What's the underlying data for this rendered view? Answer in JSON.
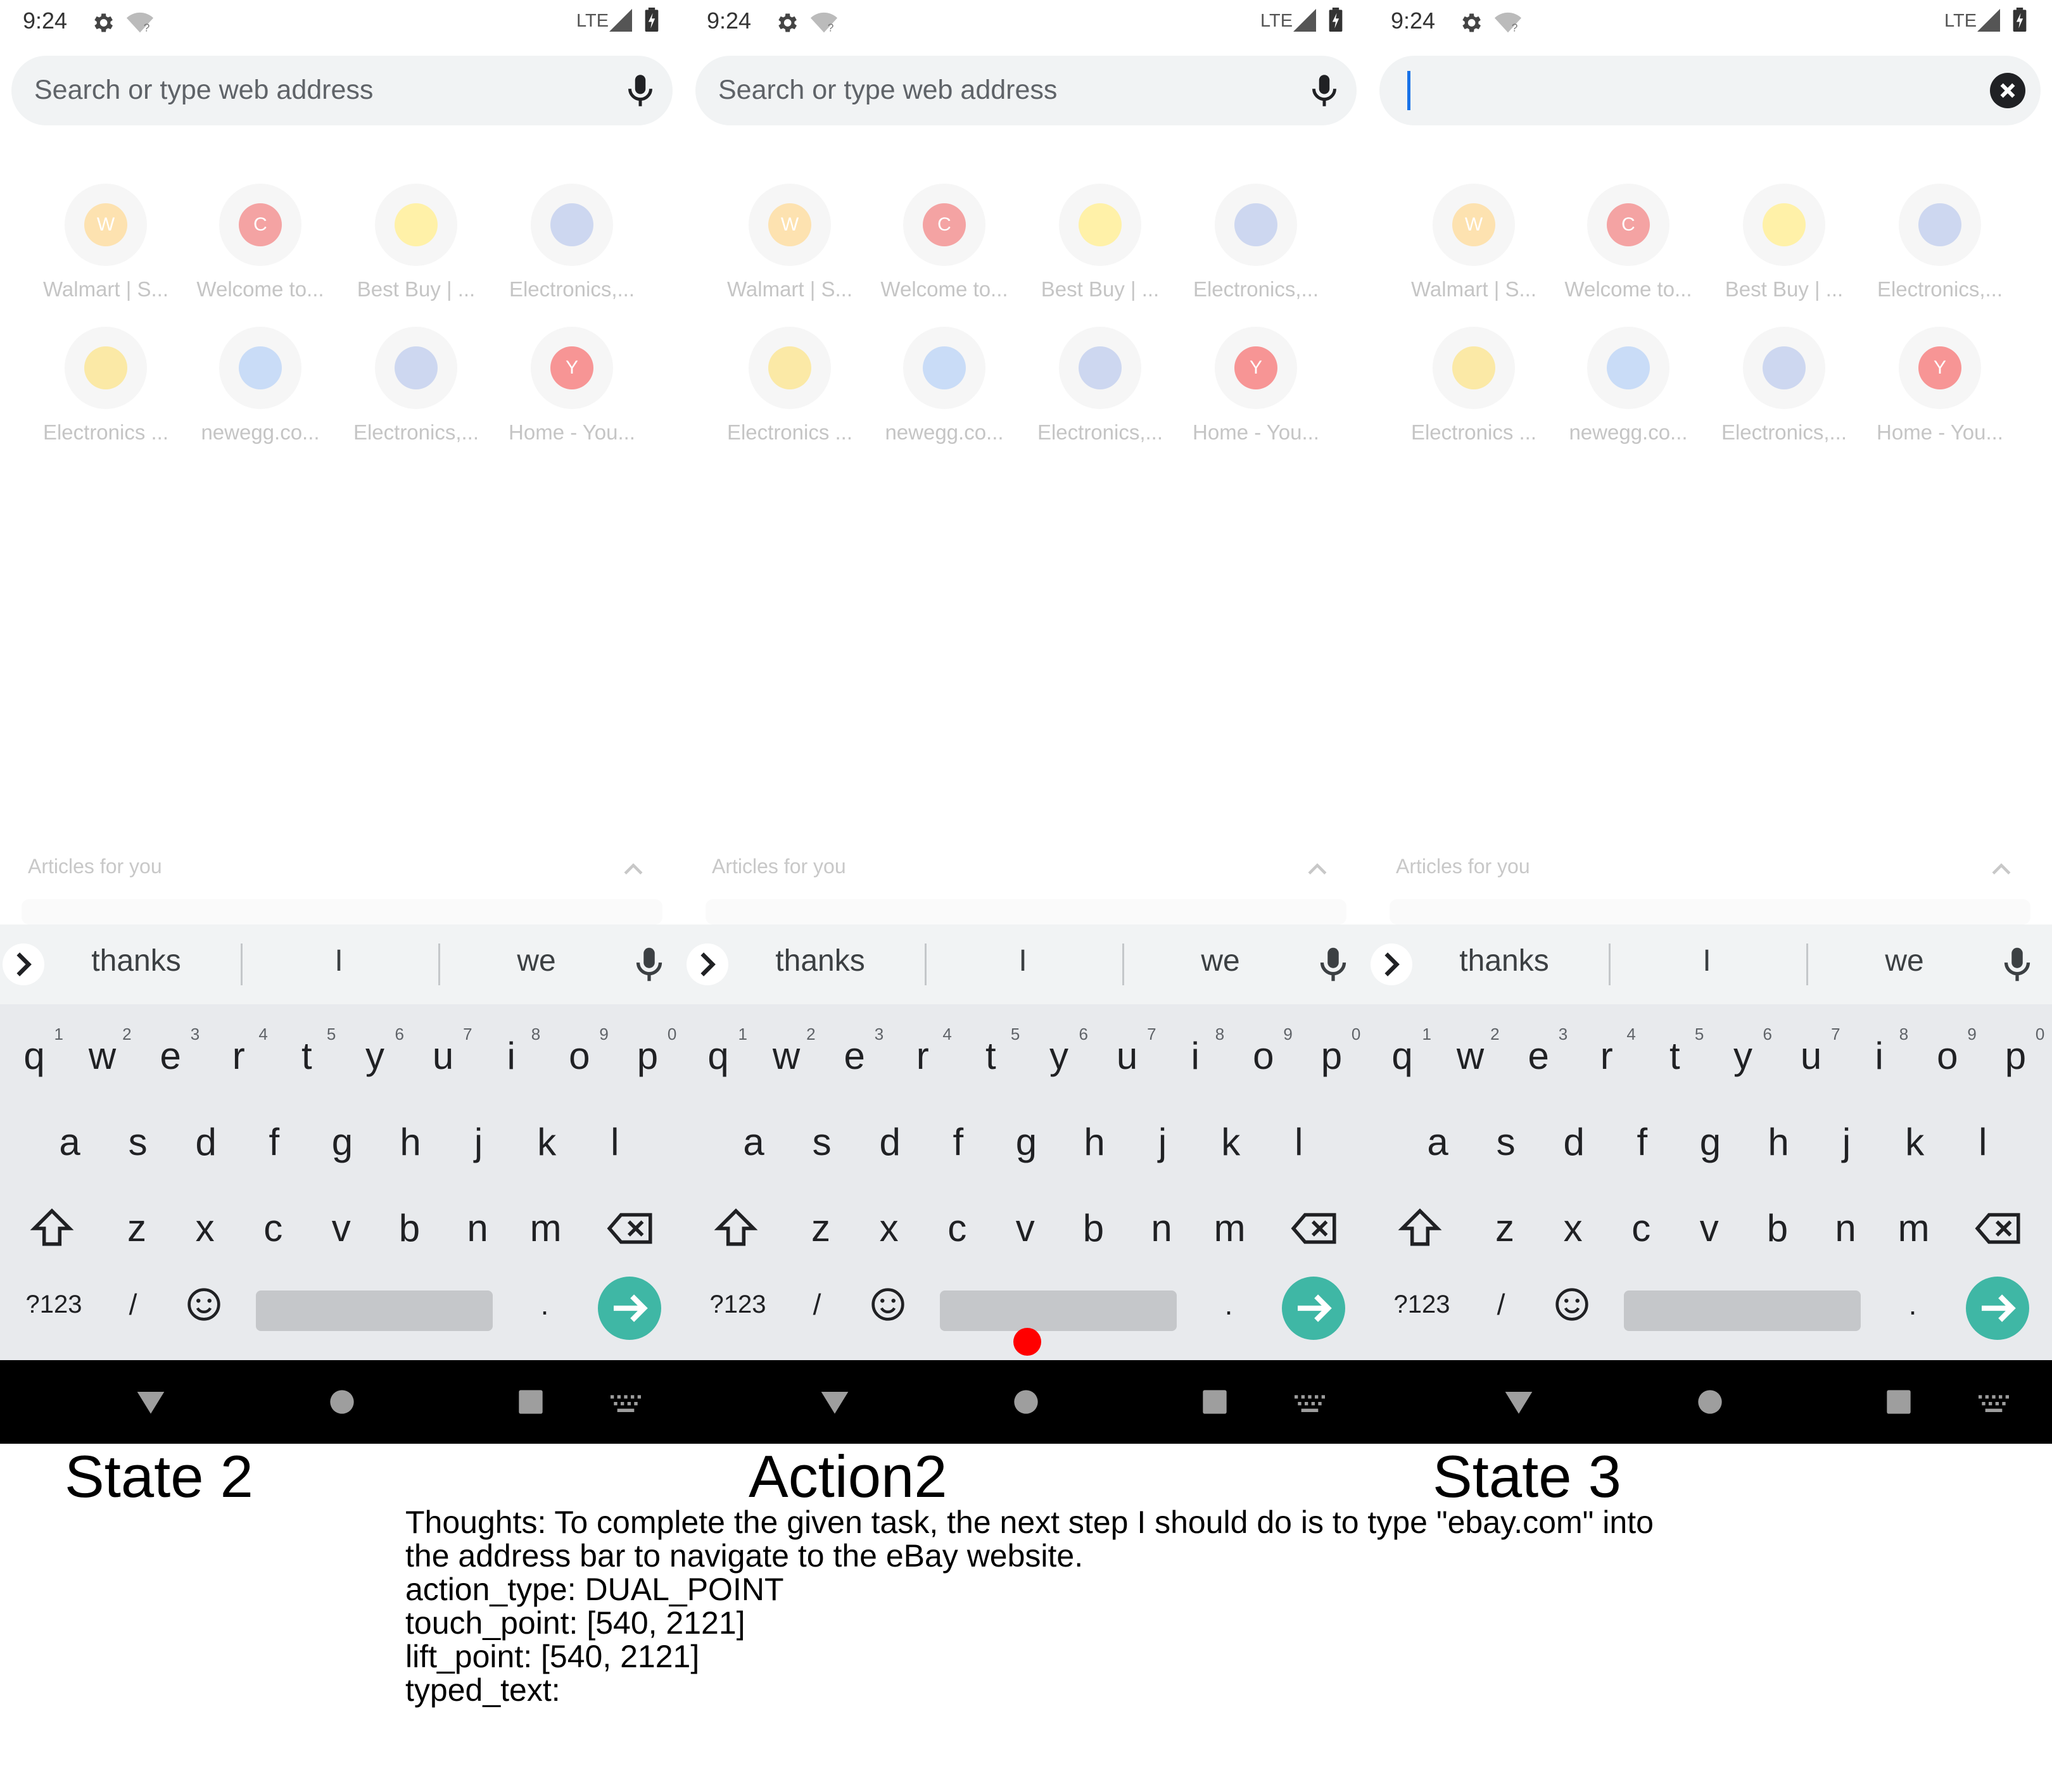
{
  "panels": [
    {
      "caption": "State 2",
      "status": {
        "time": "9:24",
        "network": "LTE"
      },
      "omnibox": {
        "placeholder": "Search or type web address",
        "focused": false
      },
      "tiles": [
        {
          "label": "Walmart | S...",
          "letter": "W",
          "color": "#fde2b0"
        },
        {
          "label": "Welcome to...",
          "letter": "C",
          "color": "#f4a3a3"
        },
        {
          "label": "Best Buy | ...",
          "letter": "",
          "color": "#fff1a8"
        },
        {
          "label": "Electronics,...",
          "letter": "",
          "color": "#cdd7f0"
        },
        {
          "label": "Electronics ...",
          "letter": "",
          "color": "#fbe9a6"
        },
        {
          "label": "newegg.co...",
          "letter": "",
          "color": "#c9dcf7"
        },
        {
          "label": "Electronics,...",
          "letter": "",
          "color": "#cdd7f0"
        },
        {
          "label": "Home - You...",
          "letter": "Y",
          "color": "#f79595"
        }
      ],
      "articles_label": "Articles for you",
      "tap": false
    },
    {
      "caption": "Action2",
      "status": {
        "time": "9:24",
        "network": "LTE"
      },
      "omnibox": {
        "placeholder": "Search or type web address",
        "focused": false
      },
      "tiles": [
        {
          "label": "Walmart | S...",
          "letter": "W",
          "color": "#fde2b0"
        },
        {
          "label": "Welcome to...",
          "letter": "C",
          "color": "#f4a3a3"
        },
        {
          "label": "Best Buy | ...",
          "letter": "",
          "color": "#fff1a8"
        },
        {
          "label": "Electronics,...",
          "letter": "",
          "color": "#cdd7f0"
        },
        {
          "label": "Electronics ...",
          "letter": "",
          "color": "#fbe9a6"
        },
        {
          "label": "newegg.co...",
          "letter": "",
          "color": "#c9dcf7"
        },
        {
          "label": "Electronics,...",
          "letter": "",
          "color": "#cdd7f0"
        },
        {
          "label": "Home - You...",
          "letter": "Y",
          "color": "#f79595"
        }
      ],
      "articles_label": "Articles for you",
      "tap": true
    },
    {
      "caption": "State 3",
      "status": {
        "time": "9:24",
        "network": "LTE"
      },
      "omnibox": {
        "placeholder": "",
        "focused": true
      },
      "tiles": [
        {
          "label": "Walmart | S...",
          "letter": "W",
          "color": "#fde2b0"
        },
        {
          "label": "Welcome to...",
          "letter": "C",
          "color": "#f4a3a3"
        },
        {
          "label": "Best Buy | ...",
          "letter": "",
          "color": "#fff1a8"
        },
        {
          "label": "Electronics,...",
          "letter": "",
          "color": "#cdd7f0"
        },
        {
          "label": "Electronics ...",
          "letter": "",
          "color": "#fbe9a6"
        },
        {
          "label": "newegg.co...",
          "letter": "",
          "color": "#c9dcf7"
        },
        {
          "label": "Electronics,...",
          "letter": "",
          "color": "#cdd7f0"
        },
        {
          "label": "Home - You...",
          "letter": "Y",
          "color": "#f79595"
        }
      ],
      "articles_label": "Articles for you",
      "tap": false
    }
  ],
  "keyboard": {
    "suggestions": [
      "thanks",
      "I",
      "we"
    ],
    "row1": [
      {
        "k": "q",
        "h": "1"
      },
      {
        "k": "w",
        "h": "2"
      },
      {
        "k": "e",
        "h": "3"
      },
      {
        "k": "r",
        "h": "4"
      },
      {
        "k": "t",
        "h": "5"
      },
      {
        "k": "y",
        "h": "6"
      },
      {
        "k": "u",
        "h": "7"
      },
      {
        "k": "i",
        "h": "8"
      },
      {
        "k": "o",
        "h": "9"
      },
      {
        "k": "p",
        "h": "0"
      }
    ],
    "row2": [
      "a",
      "s",
      "d",
      "f",
      "g",
      "h",
      "j",
      "k",
      "l"
    ],
    "row3": [
      "z",
      "x",
      "c",
      "v",
      "b",
      "n",
      "m"
    ],
    "symbols_label": "?123",
    "slash_label": "/",
    "period_label": "."
  },
  "thoughts": {
    "line1": "Thoughts: To complete the given task, the next step I should do is to type \"ebay.com\" into",
    "line2": "the address bar to navigate to the eBay website.",
    "action_type": "action_type: DUAL_POINT",
    "touch_point": "touch_point: [540, 2121]",
    "lift_point": "lift_point: [540, 2121]",
    "typed_text": "typed_text:"
  },
  "colors": {
    "accent": "#1a73e8",
    "enter_key": "#3fb7a5",
    "tap_marker": "#ff0000"
  }
}
